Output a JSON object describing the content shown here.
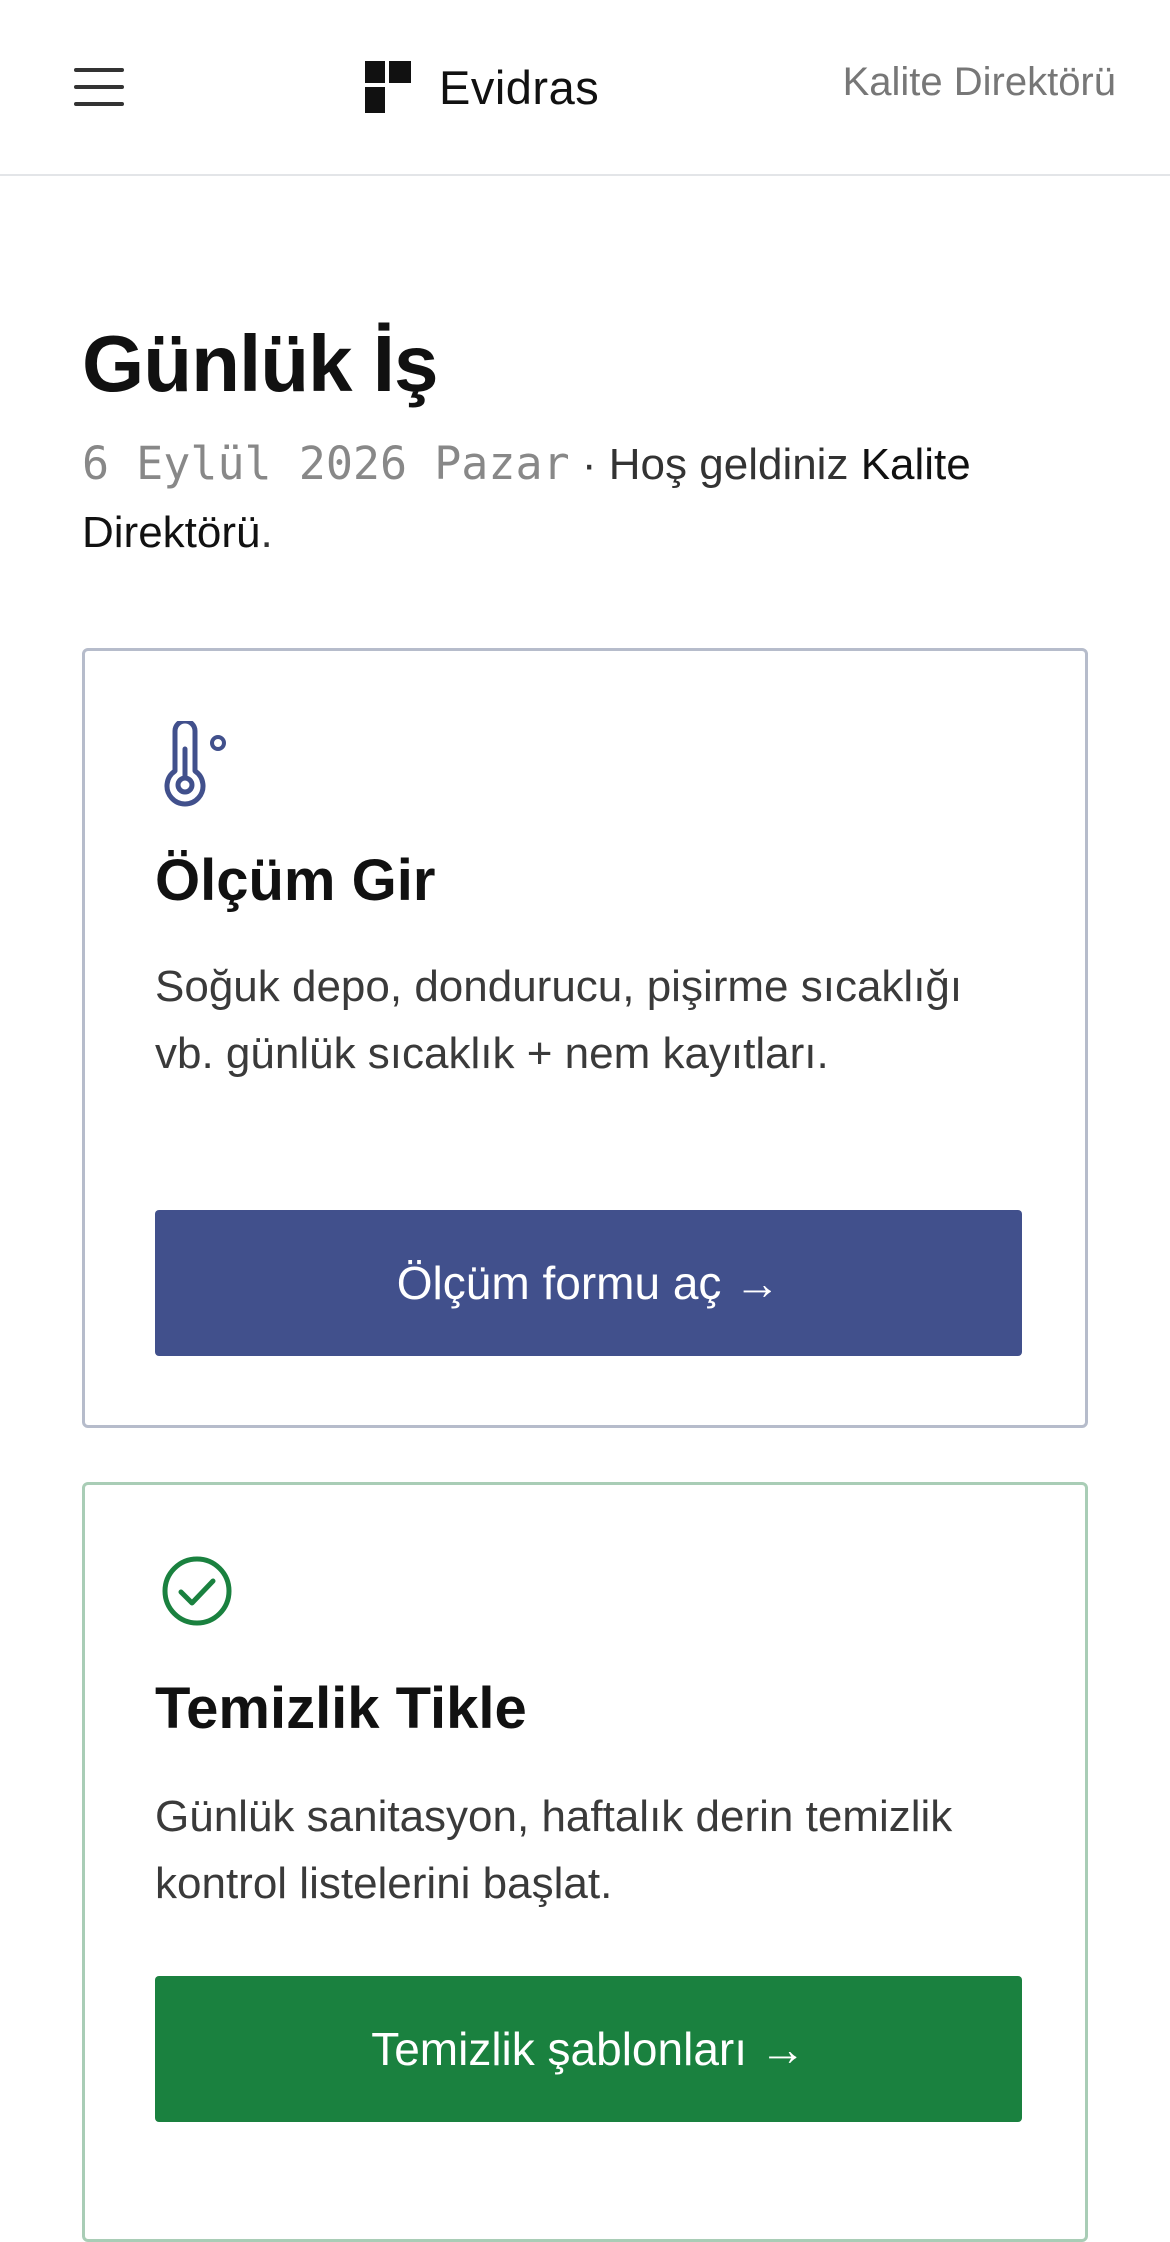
{
  "header": {
    "brand_name": "Evidras",
    "user_role": "Kalite Direktörü",
    "menu_icon": "hamburger-menu-icon",
    "logo_icon": "evidras-logo-icon"
  },
  "page": {
    "title": "Günlük İş",
    "date": "6 Eylül 2026 Pazar",
    "separator": " · ",
    "welcome_prefix": "Hoş geldiniz ",
    "welcome_role": "Kalite Direktörü",
    "welcome_suffix": "."
  },
  "cards": [
    {
      "icon": "thermometer-icon",
      "title": "Ölçüm Gir",
      "description": "Soğuk depo, dondurucu, pişirme sıcaklığı vb. günlük sıcaklık + nem kayıtları.",
      "button_label": "Ölçüm formu aç →",
      "accent_color": "#41508c"
    },
    {
      "icon": "check-circle-icon",
      "title": "Temizlik Tikle",
      "description": "Günlük sanitasyon, haftalık derin temizlik kontrol listelerini başlat.",
      "button_label": "Temizlik şablonları →",
      "accent_color": "#1a813f"
    }
  ]
}
